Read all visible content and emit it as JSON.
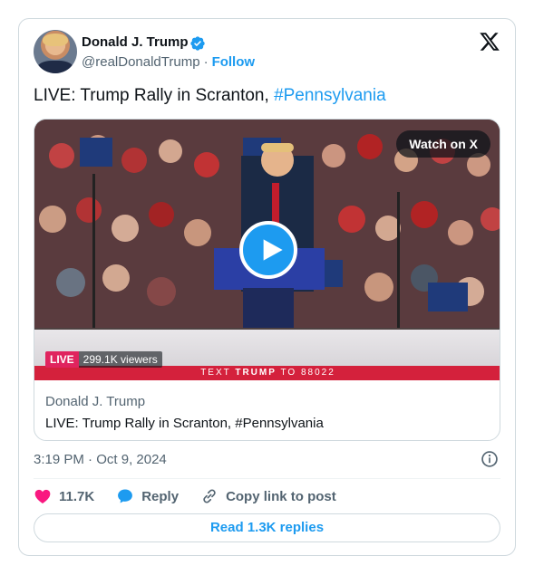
{
  "author": {
    "name": "Donald J. Trump",
    "handle": "@realDonaldTrump",
    "separator": "·",
    "follow_label": "Follow"
  },
  "tweet": {
    "text": "LIVE: Trump Rally in Scranton, ",
    "hashtag": "#Pennsylvania"
  },
  "media": {
    "watch_label": "Watch on X",
    "live_label": "LIVE",
    "viewers": "299.1K viewers",
    "banner_prefix": "TEXT ",
    "banner_bold": "TRUMP",
    "banner_suffix": " TO 88022",
    "link_domain": "Donald J. Trump",
    "link_title": "LIVE: Trump Rally in Scranton, #Pennsylvania"
  },
  "meta": {
    "time": "3:19 PM",
    "separator": "·",
    "date": "Oct 9, 2024"
  },
  "actions": {
    "like_count": "11.7K",
    "reply_label": "Reply",
    "copy_label": "Copy link to post"
  },
  "footer": {
    "read_replies": "Read 1.3K replies"
  },
  "colors": {
    "accent": "#1d9bf0",
    "like": "#f91880",
    "live": "#e0245e",
    "banner": "#d4213c"
  },
  "icons": [
    "verified-badge-icon",
    "x-logo-icon",
    "play-icon",
    "heart-icon",
    "reply-bubble-icon",
    "link-icon",
    "info-icon"
  ]
}
